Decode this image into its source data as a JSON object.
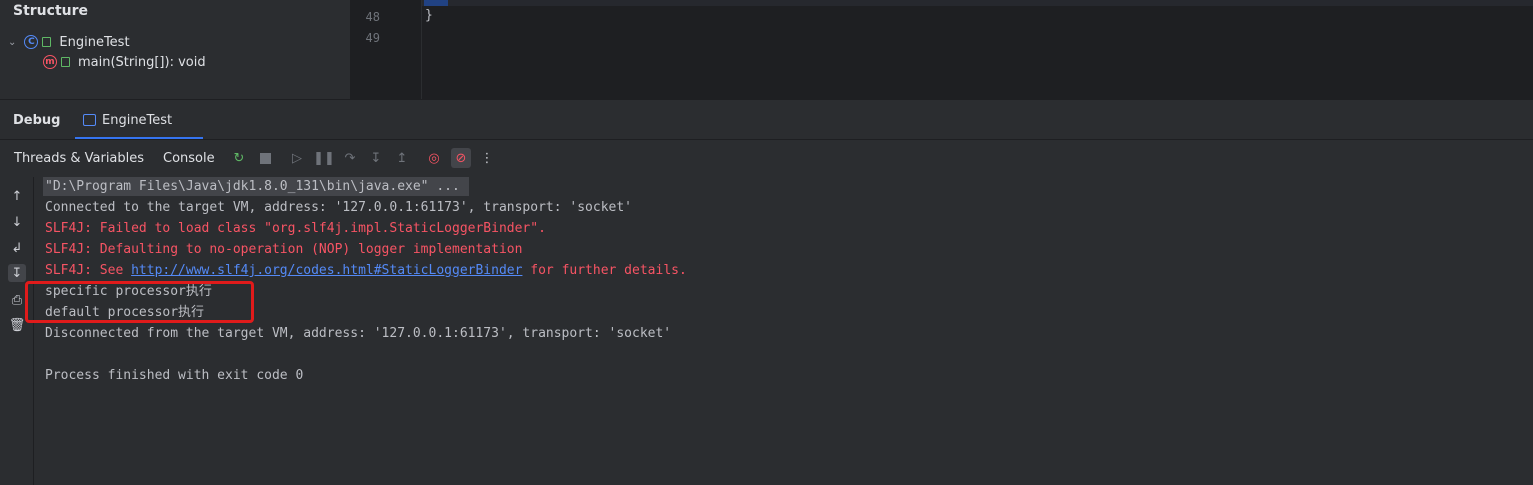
{
  "structure": {
    "title": "Structure",
    "class_name": "EngineTest",
    "method_name": "main(String[]): void",
    "class_icon_letter": "C",
    "method_icon_letter": "m"
  },
  "editor": {
    "line_numbers": [
      "48",
      "49"
    ],
    "code_line": "}"
  },
  "debug": {
    "title": "Debug",
    "run_tab_label": "EngineTest"
  },
  "toolbar": {
    "tabs": [
      "Threads & Variables",
      "Console"
    ]
  },
  "console": {
    "lines": [
      {
        "text": "\"D:\\Program Files\\Java\\jdk1.8.0_131\\bin\\java.exe\" ...",
        "kind": "gray"
      },
      {
        "text": "Connected to the target VM, address: '127.0.0.1:61173', transport: 'socket'",
        "kind": "gray"
      },
      {
        "text": "SLF4J: Failed to load class \"org.slf4j.impl.StaticLoggerBinder\".",
        "kind": "red"
      },
      {
        "text": "SLF4J: Defaulting to no-operation (NOP) logger implementation",
        "kind": "red"
      },
      {
        "prefix": "SLF4J: See ",
        "link": "http://www.slf4j.org/codes.html#StaticLoggerBinder",
        "suffix": " for further details.",
        "kind": "red-link"
      },
      {
        "text": "specific processor执行",
        "kind": "gray"
      },
      {
        "text": "default processor执行",
        "kind": "gray"
      },
      {
        "text": "Disconnected from the target VM, address: '127.0.0.1:61173', transport: 'socket'",
        "kind": "gray"
      },
      {
        "text": "",
        "kind": "gray"
      },
      {
        "text": "Process finished with exit code 0",
        "kind": "gray"
      }
    ]
  },
  "colors": {
    "accent": "#3574f0",
    "error": "#f75464",
    "link": "#548af7",
    "highlight": "#e01b1b"
  }
}
